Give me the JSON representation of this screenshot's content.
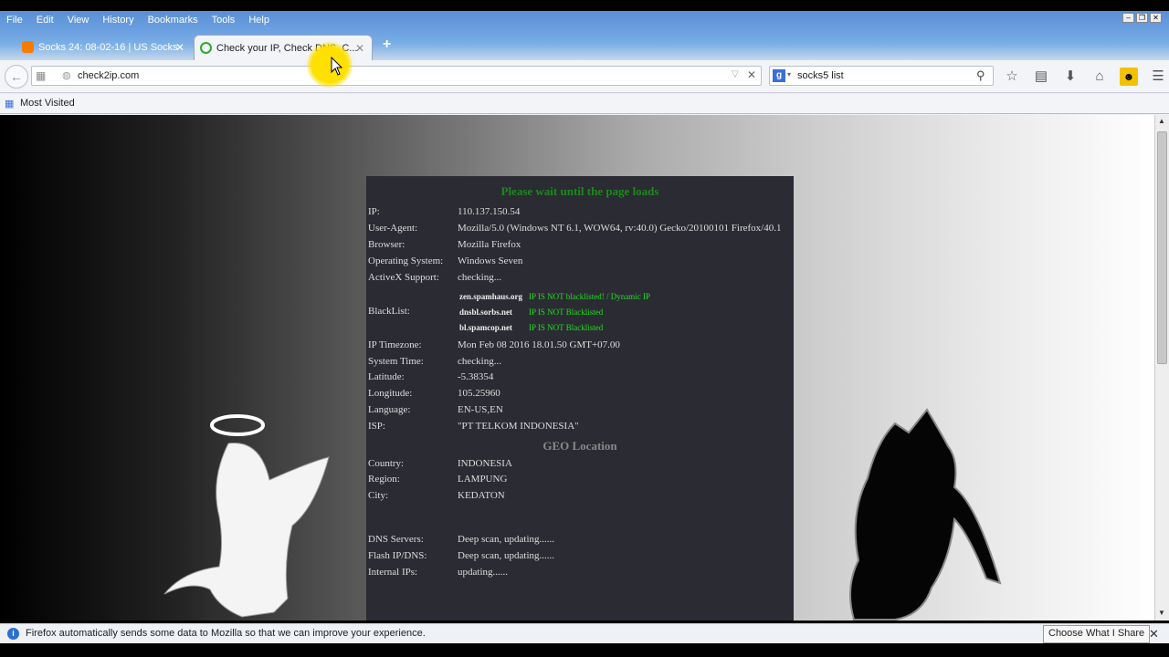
{
  "menu": [
    "File",
    "Edit",
    "View",
    "History",
    "Bookmarks",
    "Tools",
    "Help"
  ],
  "tabs": [
    {
      "title": "Socks 24: 08-02-16 | US Socks",
      "active": false
    },
    {
      "title": "Check your IP, Check DNS, C...",
      "active": true
    }
  ],
  "url": "check2ip.com",
  "search": "socks5 list",
  "bookmarks": {
    "most_visited": "Most Visited"
  },
  "page": {
    "wait": "Please wait until the page loads",
    "rows": [
      {
        "k": "IP:",
        "v": "110.137.150.54"
      },
      {
        "k": "User-Agent:",
        "v": "Mozilla/5.0 (Windows NT 6.1, WOW64, rv:40.0) Gecko/20100101 Firefox/40.1"
      },
      {
        "k": "Browser:",
        "v": "Mozilla Firefox"
      },
      {
        "k": "Operating System:",
        "v": "Windows Seven"
      },
      {
        "k": "ActiveX Support:",
        "v": "checking..."
      }
    ],
    "blacklist_label": "BlackList:",
    "blacklist": [
      {
        "srv": "zen.spamhaus.org",
        "st": "IP IS NOT blacklisted! / Dynamic IP"
      },
      {
        "srv": "dnsbl.sorbs.net",
        "st": "IP IS NOT Blacklisted"
      },
      {
        "srv": "bl.spamcop.net",
        "st": "IP IS NOT Blacklisted"
      }
    ],
    "rows2": [
      {
        "k": "IP Timezone:",
        "v": "Mon Feb 08 2016 18.01.50 GMT+07.00"
      },
      {
        "k": "System Time:",
        "v": "checking..."
      },
      {
        "k": "Latitude:",
        "v": "-5.38354"
      },
      {
        "k": "Longitude:",
        "v": "105.25960"
      },
      {
        "k": "Language:",
        "v": "EN-US,EN"
      },
      {
        "k": "ISP:",
        "v": "\"PT TELKOM INDONESIA\""
      }
    ],
    "geo_title": "GEO Location",
    "geo": [
      {
        "k": "Country:",
        "v": "INDONESIA"
      },
      {
        "k": "Region:",
        "v": "LAMPUNG"
      },
      {
        "k": "City:",
        "v": "KEDATON"
      }
    ],
    "dns": [
      {
        "k": "DNS Servers:",
        "v": "Deep scan, updating......"
      },
      {
        "k": "Flash IP/DNS:",
        "v": "Deep scan, updating......"
      },
      {
        "k": "Internal IPs:",
        "v": "updating......"
      }
    ]
  },
  "notification": {
    "text": "Firefox automatically sends some data to Mozilla so that we can improve your experience.",
    "button": "Choose What I Share"
  }
}
